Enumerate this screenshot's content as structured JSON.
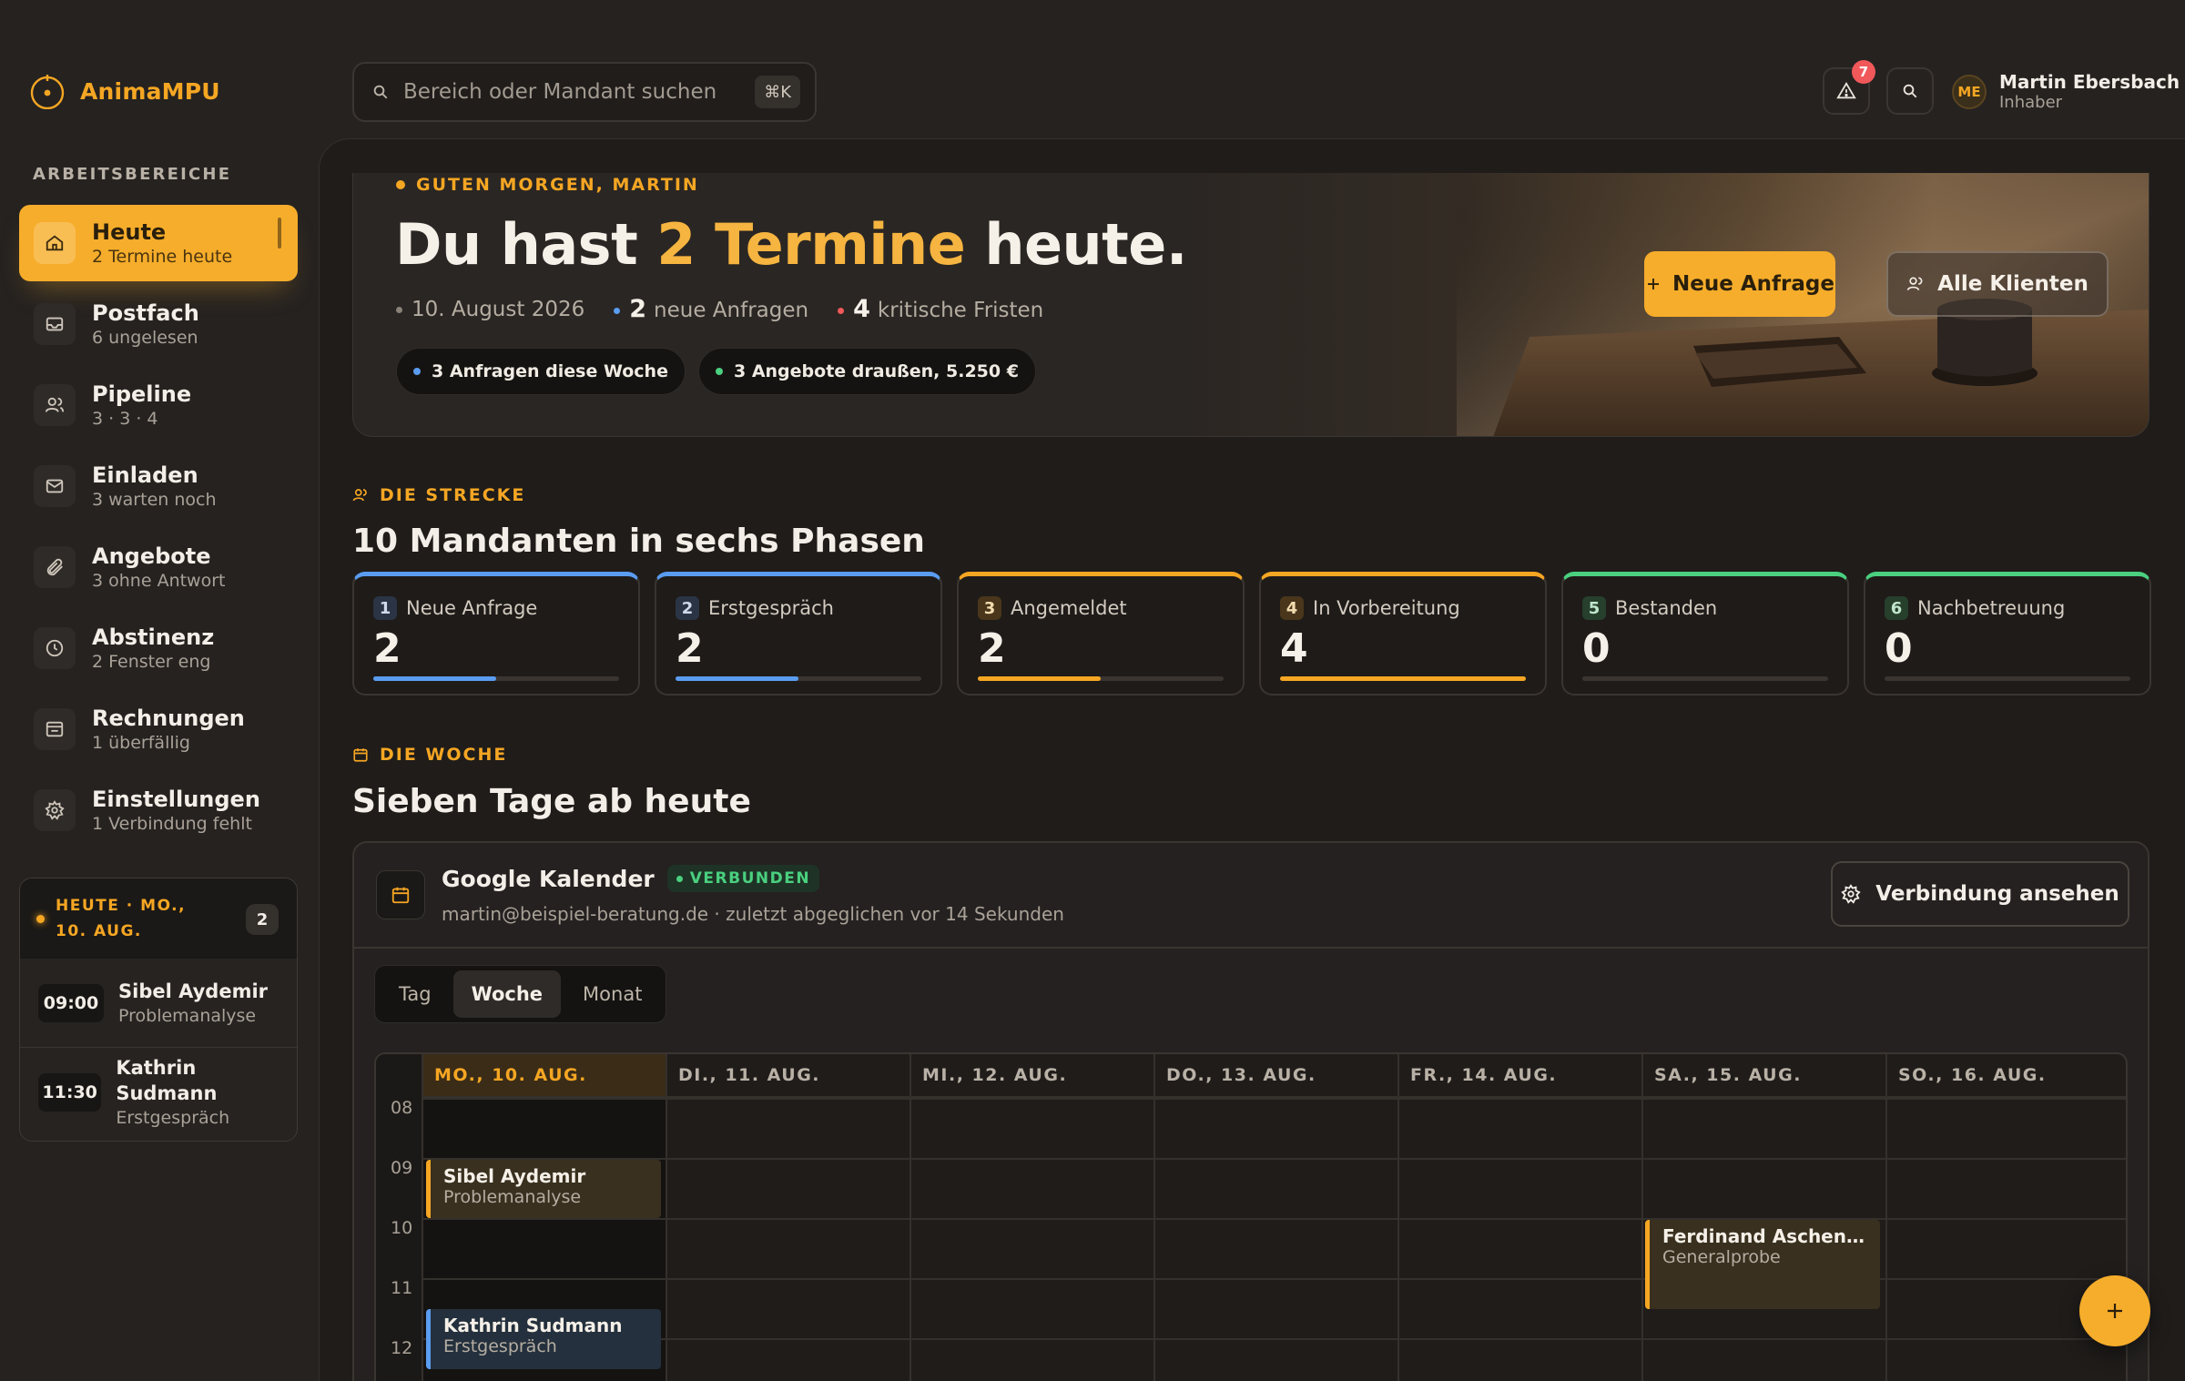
{
  "brand": {
    "name": "AnimaMPU"
  },
  "sidebar": {
    "section_label": "ARBEITSBEREICHE",
    "items": [
      {
        "label": "Heute",
        "sub": "2 Termine heute",
        "icon": "home-icon",
        "active": true
      },
      {
        "label": "Postfach",
        "sub": "6 ungelesen",
        "icon": "inbox-icon"
      },
      {
        "label": "Pipeline",
        "sub": "3 · 3 · 4",
        "icon": "users-icon"
      },
      {
        "label": "Einladen",
        "sub": "3 warten noch",
        "icon": "mail-icon"
      },
      {
        "label": "Angebote",
        "sub": "3 ohne Antwort",
        "icon": "paperclip-icon"
      },
      {
        "label": "Abstinenz",
        "sub": "2 Fenster eng",
        "icon": "clock-icon"
      },
      {
        "label": "Rechnungen",
        "sub": "1 überfällig",
        "icon": "folder-icon"
      },
      {
        "label": "Einstellungen",
        "sub": "1 Verbindung fehlt",
        "icon": "gear-icon"
      }
    ],
    "today_card": {
      "title": "HEUTE · MO., 10. AUG.",
      "count": "2",
      "appointments": [
        {
          "time": "09:00",
          "name": "Sibel Aydemir",
          "type": "Problemanalyse"
        },
        {
          "time": "11:30",
          "name": "Kathrin Sudmann",
          "type": "Erstgespräch"
        }
      ]
    }
  },
  "topbar": {
    "search_placeholder": "Bereich oder Mandant suchen",
    "shortcut": "⌘K",
    "alert_count": "7",
    "user": {
      "initials": "ME",
      "name": "Martin Ebersbach",
      "role": "Inhaber"
    }
  },
  "hero": {
    "greeting": "GUTEN MORGEN, MARTIN",
    "headline_pre": "Du hast ",
    "headline_highlight": "2 Termine",
    "headline_post": " heute.",
    "date": "10. August 2026",
    "new_requests_count": "2",
    "new_requests_label": "neue Anfragen",
    "critical_count": "4",
    "critical_label": "kritische Fristen",
    "chips": [
      {
        "label": "3 Anfragen diese Woche",
        "color": "#5a9cf0"
      },
      {
        "label": "3 Angebote draußen, 5.250 €",
        "color": "#4ad07f"
      }
    ],
    "primary_button": "Neue Anfrage",
    "secondary_button": "Alle Klienten"
  },
  "pipeline": {
    "label": "DIE STRECKE",
    "title": "10 Mandanten in sechs Phasen",
    "phases": [
      {
        "num": "1",
        "name": "Neue Anfrage",
        "count": "2",
        "color": "#5a9cf0",
        "fill": 0.5
      },
      {
        "num": "2",
        "name": "Erstgespräch",
        "count": "2",
        "color": "#5a9cf0",
        "fill": 0.5
      },
      {
        "num": "3",
        "name": "Angemeldet",
        "count": "2",
        "color": "#f5a623",
        "fill": 0.5
      },
      {
        "num": "4",
        "name": "In Vorbereitung",
        "count": "4",
        "color": "#f5a623",
        "fill": 1.0
      },
      {
        "num": "5",
        "name": "Bestanden",
        "count": "0",
        "color": "#4ad07f",
        "fill": 0
      },
      {
        "num": "6",
        "name": "Nachbetreuung",
        "count": "0",
        "color": "#4ad07f",
        "fill": 0
      }
    ]
  },
  "week": {
    "label": "DIE WOCHE",
    "title": "Sieben Tage ab heute",
    "calendar": {
      "name": "Google Kalender",
      "status": "VERBUNDEN",
      "sub": "martin@beispiel-beratung.de · zuletzt abgeglichen vor 14 Sekunden",
      "button": "Verbindung ansehen"
    },
    "views": [
      "Tag",
      "Woche",
      "Monat"
    ],
    "active_view": "Woche",
    "days": [
      "MO., 10. AUG.",
      "DI., 11. AUG.",
      "MI., 12. AUG.",
      "DO., 13. AUG.",
      "FR., 14. AUG.",
      "SA., 15. AUG.",
      "SO., 16. AUG."
    ],
    "hours": [
      "08",
      "09",
      "10",
      "11",
      "12"
    ],
    "events": [
      {
        "name": "Sibel Aydemir",
        "type": "Problemanalyse",
        "color": "#f5a623"
      },
      {
        "name": "Kathrin Sudmann",
        "type": "Erstgespräch",
        "color": "#5a9cf0"
      },
      {
        "name": "Ferdinand Aschenbre...",
        "type": "Generalprobe",
        "color": "#f5a623"
      }
    ]
  }
}
